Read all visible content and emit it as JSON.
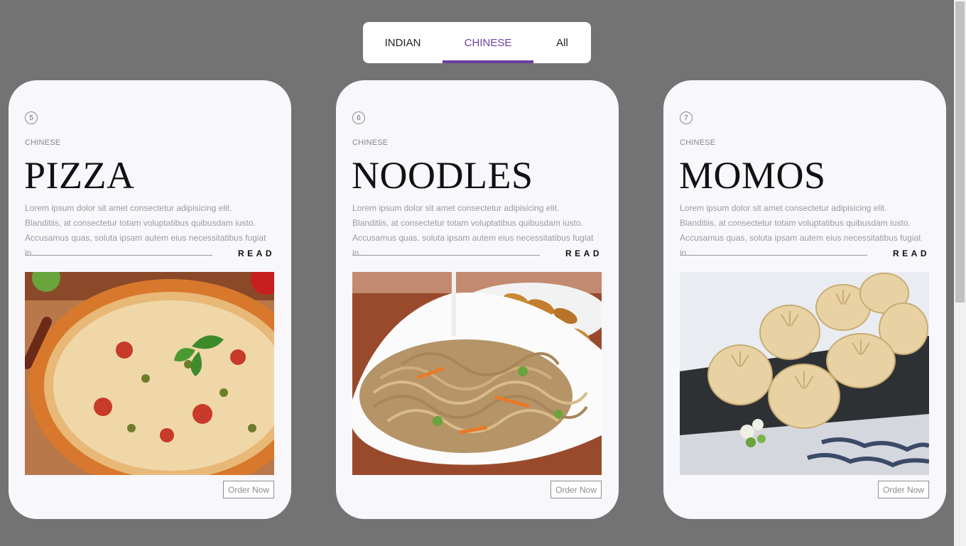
{
  "tabs": {
    "items": [
      {
        "label": "INDIAN",
        "active": false
      },
      {
        "label": "CHINESE",
        "active": true
      },
      {
        "label": "All",
        "active": false
      }
    ],
    "accent_color": "#6a3fa0"
  },
  "cards": [
    {
      "number": "5",
      "category": "CHINESE",
      "title": "PIZZA",
      "description": "Lorem ipsum dolor sit amet consectetur adipisicing elit. Blanditiis, at consectetur totam voluptatibus quibusdam iusto. Accusamus quas, soluta ipsam autem eius necessitatibus fugiat in .",
      "read_label": "READ",
      "image": "pizza-photo",
      "order_label": "Order Now"
    },
    {
      "number": "6",
      "category": "CHINESE",
      "title": "NOODLES",
      "description": "Lorem ipsum dolor sit amet consectetur adipisicing elit. Blanditiis, at consectetur totam voluptatibus quibusdam iusto. Accusamus quas, soluta ipsam autem eius necessitatibus fugiat in .",
      "read_label": "READ",
      "image": "noodles-photo",
      "order_label": "Order Now"
    },
    {
      "number": "7",
      "category": "CHINESE",
      "title": "MOMOS",
      "description": "Lorem ipsum dolor sit amet consectetur adipisicing elit. Blanditiis, at consectetur totam voluptatibus quibusdam iusto. Accusamus quas, soluta ipsam autem eius necessitatibus fugiat in .",
      "read_label": "READ",
      "image": "momos-photo",
      "order_label": "Order Now"
    }
  ],
  "colors": {
    "page_background": "#737373",
    "card_background": "#f7f7fc"
  }
}
